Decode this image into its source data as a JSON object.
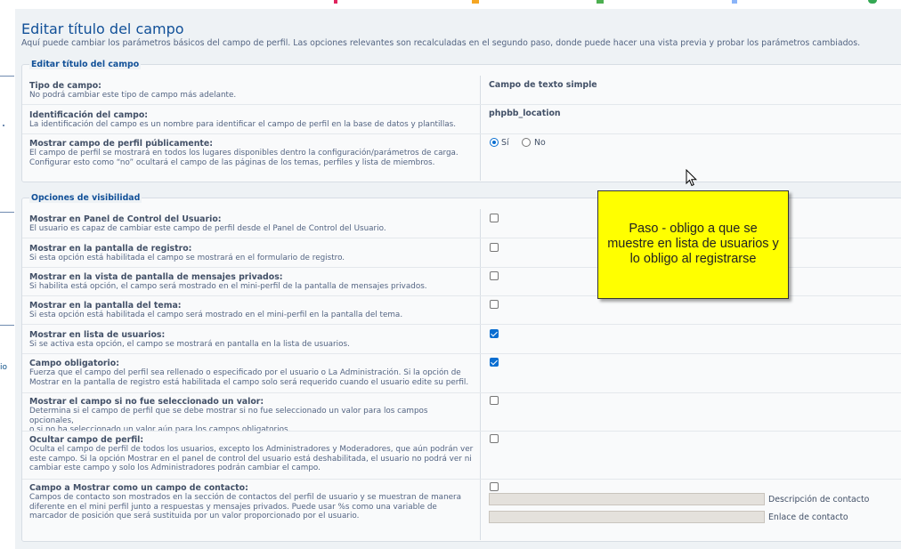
{
  "page": {
    "title": "Editar título del campo",
    "description": "Aquí puede cambiar los parámetros básicos del campo de perfil. Las opciones relevantes son recalculadas en el segundo paso, donde puede hacer una vista previa y probar los parámetros cambiados."
  },
  "leftnav": {
    "fragment": "io"
  },
  "section1": {
    "legend": "Editar título del campo",
    "field_type": {
      "label": "Tipo de campo:",
      "explain": "No podrá cambiar este tipo de campo más adelante.",
      "value": "Campo de texto simple"
    },
    "field_ident": {
      "label": "Identificación del campo:",
      "explain": "La identificación del campo es un nombre para identificar el campo de perfil en la base de datos y plantillas.",
      "value": "phpbb_location"
    },
    "public": {
      "label": "Mostrar campo de perfil públicamente:",
      "explain_1": "El campo de perfil se mostrará en todos los lugares disponibles dentro la configuración/parámetros de carga.",
      "explain_2": "Configurar esto como “no” ocultará el campo de las páginas de los temas, perfiles y lista de miembros.",
      "yes_label": "Sí",
      "no_label": "No",
      "selected": "yes"
    }
  },
  "section2": {
    "legend": "Opciones de visibilidad",
    "options": [
      {
        "label": "Mostrar en Panel de Control del Usuario:",
        "explain": [
          "El usuario es capaz de cambiar este campo de perfil desde el Panel de Control del Usuario."
        ],
        "checked": false
      },
      {
        "label": "Mostrar en la pantalla de registro:",
        "explain": [
          "Si esta opción está habilitada el campo se mostrará en el formulario de registro."
        ],
        "checked": false
      },
      {
        "label": "Mostrar en la vista de pantalla de mensajes privados:",
        "explain": [
          "Si habilita está opción, el campo será mostrado en el mini-perfil de la pantalla de mensajes privados."
        ],
        "checked": false
      },
      {
        "label": "Mostrar en la pantalla del tema:",
        "explain": [
          "Si esta opción está habilitada el campo será mostrado en el mini-perfil en la pantalla del tema."
        ],
        "checked": false
      },
      {
        "label": "Mostrar en lista de usuarios:",
        "explain": [
          "Si se activa esta opción, el campo se mostrará en pantalla en la lista de usuarios."
        ],
        "checked": true
      },
      {
        "label": "Campo obligatorio:",
        "explain": [
          "Fuerza que el campo del perfil sea rellenado o especificado por el usuario o La Administración. Si la opción de",
          "Mostrar en la pantalla de registro está habilitada el campo solo será requerido cuando el usuario edite su perfil."
        ],
        "checked": true
      },
      {
        "label": "Mostrar el campo si no fue seleccionado un valor:",
        "explain": [
          "Determina si el campo de perfil que se debe mostrar si no fue seleccionado un valor para los campos opcionales,",
          "o si no ha seleccionado un valor aún para los campos obligatorios."
        ],
        "checked": false
      },
      {
        "label": "Ocultar campo de perfil:",
        "explain": [
          "Oculta el campo de perfil de todos los usuarios, excepto los Administradores y Moderadores, que aún podrán ver",
          "este campo. Si la opción Mostrar en el panel de control del usuario está deshabilitada, el usuario no podrá ver ni",
          "cambiar este campo y solo los Administradores podrán cambiar el campo."
        ],
        "checked": false
      },
      {
        "label": "Campo a Mostrar como un campo de contacto:",
        "explain": [
          "Campos de contacto son mostrados en la sección de contactos del perfil de usuario y se muestran de manera",
          "diferente en el mini perfil junto a respuestas y mensajes privados. Puede usar %s como una variable de",
          "marcador de posición que será sustituida por un valor proporcionado por el usuario."
        ],
        "checked": false
      }
    ],
    "contact_desc_label": "Descripción de contacto",
    "contact_link_label": "Enlace de contacto"
  },
  "note": {
    "text": "Paso - obligo a que se muestre en lista de usuarios y lo obligo al registrarse",
    "background": "#ffff00"
  },
  "colors": {
    "title": "#115098",
    "panel": "#eef2f5",
    "checkbox_on": "#0a6ed1"
  }
}
